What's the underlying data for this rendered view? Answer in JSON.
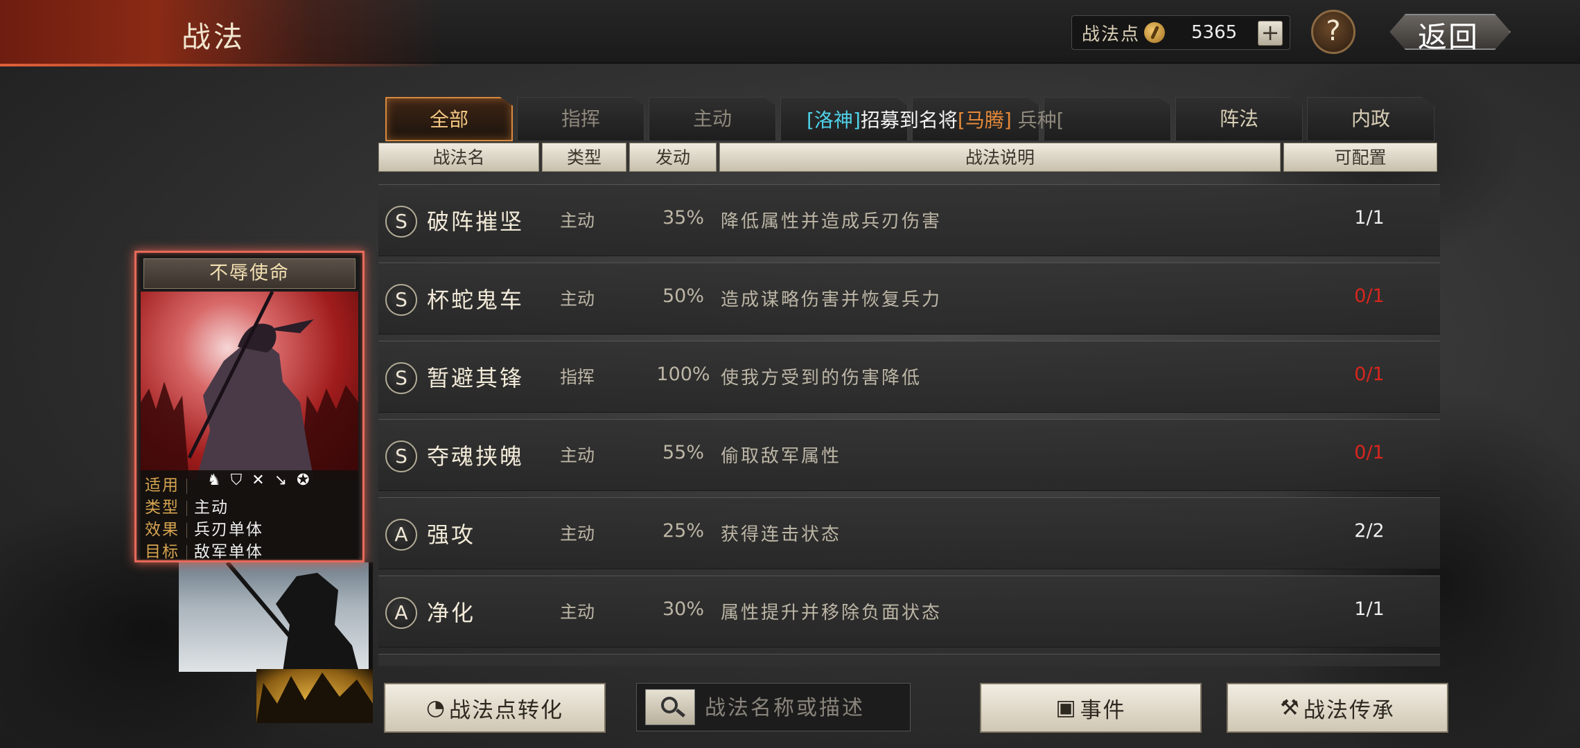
{
  "header": {
    "title": "战法",
    "points_label": "战法点",
    "points_value": "5365",
    "add_label": "+",
    "help_label": "?",
    "back_label": "返回"
  },
  "tabs": [
    {
      "label": "全部",
      "active": true
    },
    {
      "label": "指挥",
      "active": false
    },
    {
      "label": "主动",
      "active": false
    },
    {
      "label": "",
      "active": false
    },
    {
      "label": "",
      "active": false
    },
    {
      "label": "",
      "active": false
    },
    {
      "label": "阵法",
      "active": false
    },
    {
      "label": "内政",
      "active": false
    }
  ],
  "ticker": {
    "part1": "[洛神",
    "part2": "]",
    "part3": "招募到名将",
    "part4": "[马腾]",
    "part5": " 兵种["
  },
  "table": {
    "headers": [
      "战法名",
      "类型",
      "发动",
      "战法说明",
      "可配置"
    ],
    "rows": [
      {
        "grade": "S",
        "name": "破阵摧坚",
        "type": "主动",
        "rate": "35%",
        "desc": "降低属性并造成兵刃伤害",
        "config": "1/1",
        "config_red": false
      },
      {
        "grade": "S",
        "name": "杯蛇鬼车",
        "type": "主动",
        "rate": "50%",
        "desc": "造成谋略伤害并恢复兵力",
        "config": "0/1",
        "config_red": true
      },
      {
        "grade": "S",
        "name": "暂避其锋",
        "type": "指挥",
        "rate": "100%",
        "desc": "使我方受到的伤害降低",
        "config": "0/1",
        "config_red": true
      },
      {
        "grade": "S",
        "name": "夺魂挟魄",
        "type": "主动",
        "rate": "55%",
        "desc": "偷取敌军属性",
        "config": "0/1",
        "config_red": true
      },
      {
        "grade": "A",
        "name": "强攻",
        "type": "主动",
        "rate": "25%",
        "desc": "获得连击状态",
        "config": "2/2",
        "config_red": false
      },
      {
        "grade": "A",
        "name": "净化",
        "type": "主动",
        "rate": "30%",
        "desc": "属性提升并移除负面状态",
        "config": "1/1",
        "config_red": false
      }
    ]
  },
  "card": {
    "title": "不辱使命",
    "stats": [
      {
        "key": "适用",
        "value": ""
      },
      {
        "key": "类型",
        "value": "主动"
      },
      {
        "key": "效果",
        "value": "兵刃单体"
      },
      {
        "key": "目标",
        "value": "敌军单体"
      }
    ],
    "troop_icons": [
      "cavalry-icon",
      "shield-icon",
      "archer-icon",
      "spear-icon",
      "wheel-icon"
    ]
  },
  "buttons": {
    "convert": "战法点转化",
    "event": "事件",
    "inherit": "战法传承"
  },
  "search": {
    "placeholder": "战法名称或描述"
  },
  "colors": {
    "accent_orange": "#d9893e",
    "config_red": "#d8261e",
    "ticker_cyan": "#4ed2e8",
    "ticker_orange": "#e78a3a"
  }
}
